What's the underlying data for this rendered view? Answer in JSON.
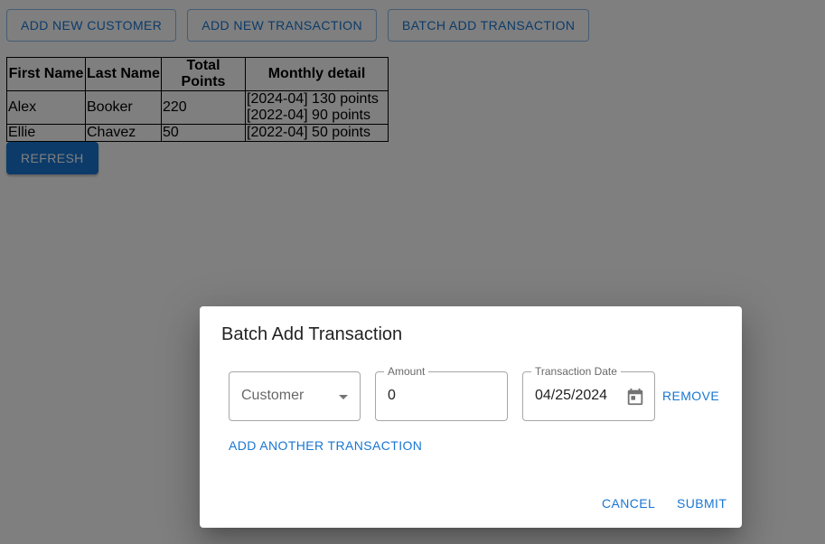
{
  "toolbar": {
    "add_customer": "ADD NEW CUSTOMER",
    "add_transaction": "ADD NEW TRANSACTION",
    "batch_add_transaction": "BATCH ADD TRANSACTION"
  },
  "table": {
    "headers": [
      "First Name",
      "Last Name",
      "Total Points",
      "Monthly detail"
    ],
    "rows": [
      {
        "first": "Alex",
        "last": "Booker",
        "total": "220",
        "monthly": [
          "[2024-04] 130 points",
          "[2022-04] 90 points"
        ]
      },
      {
        "first": "Ellie",
        "last": "Chavez",
        "total": "50",
        "monthly": [
          "[2022-04] 50 points"
        ]
      }
    ]
  },
  "refresh_label": "REFRESH",
  "dialog": {
    "title": "Batch Add Transaction",
    "customer_placeholder": "Customer",
    "amount_label": "Amount",
    "amount_value": "0",
    "date_label": "Transaction Date",
    "date_value": "04/25/2024",
    "remove_label": "REMOVE",
    "add_another_label": "ADD ANOTHER TRANSACTION",
    "cancel_label": "CANCEL",
    "submit_label": "SUBMIT"
  },
  "colors": {
    "primary": "#1976d2",
    "backdrop": "rgba(0,0,0,0.5)"
  },
  "icons": {
    "customer_dropdown": "caret-down-icon",
    "date_picker": "calendar-icon"
  }
}
